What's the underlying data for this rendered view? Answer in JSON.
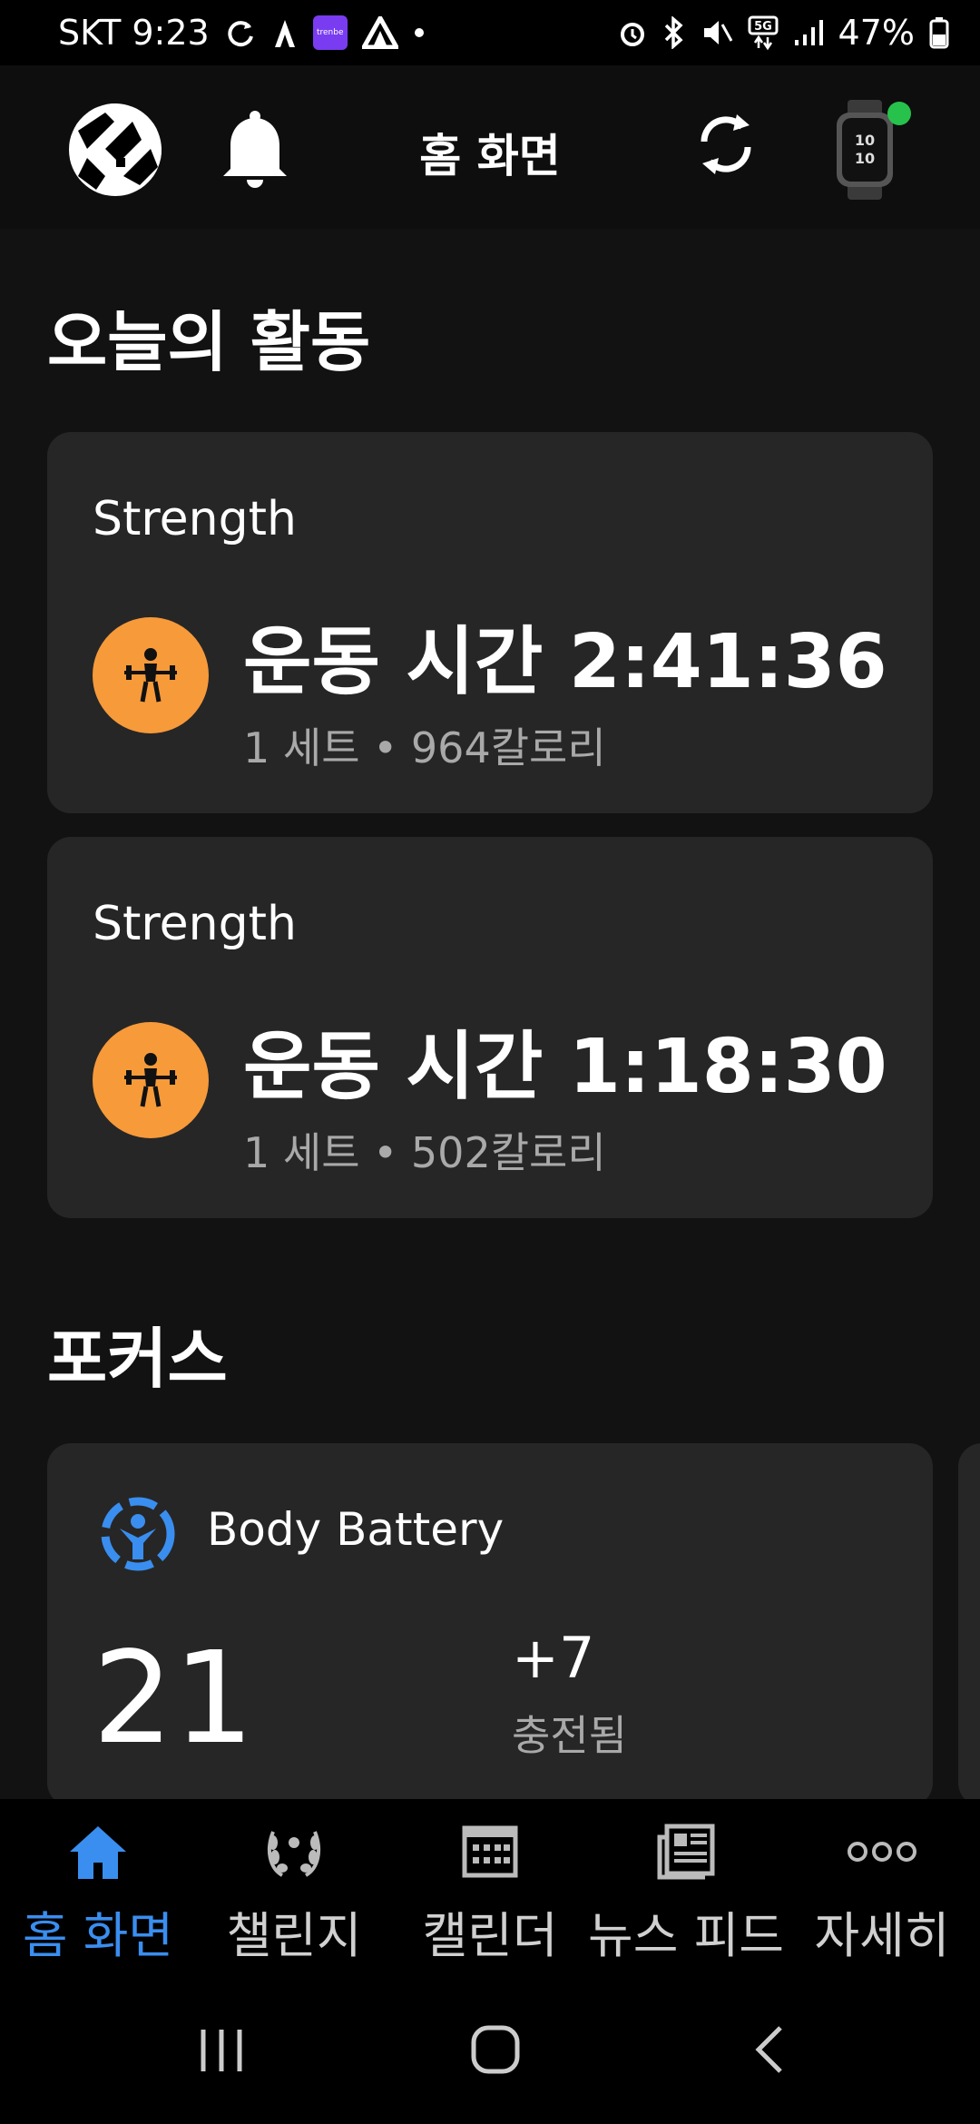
{
  "status_bar": {
    "carrier_time": "SKT 9:23",
    "app_badge": "trenbe",
    "network": "5G",
    "battery": "47%",
    "icons": [
      "sync-icon",
      "strava-icon",
      "app-badge-icon",
      "nav-app-icon",
      "dot-icon",
      "alarm-icon",
      "bluetooth-icon",
      "mute-icon",
      "5g-icon",
      "signal-icon",
      "battery-icon"
    ]
  },
  "header": {
    "title": "홈 화면",
    "icons": [
      "avatar",
      "bell-icon",
      "sync-icon",
      "watch-icon"
    ]
  },
  "today": {
    "title": "오늘의 활동",
    "activities": [
      {
        "type": "Strength",
        "main": "운동 시간 2:41:36",
        "sub": "1 세트 • 964칼로리"
      },
      {
        "type": "Strength",
        "main": "운동 시간 1:18:30",
        "sub": "1 세트 • 502칼로리"
      }
    ]
  },
  "focus": {
    "title": "포커스",
    "body_battery": {
      "label": "Body Battery",
      "value": "21",
      "delta": "+7",
      "delta_label": "충전됨"
    }
  },
  "bottom_nav": {
    "items": [
      {
        "label": "홈 화면",
        "icon": "home-icon",
        "active": true
      },
      {
        "label": "챌린지",
        "icon": "laurel-icon",
        "active": false
      },
      {
        "label": "캘린더",
        "icon": "calendar-icon",
        "active": false
      },
      {
        "label": "뉴스 피드",
        "icon": "newsfeed-icon",
        "active": false
      },
      {
        "label": "자세히",
        "icon": "more-icon",
        "active": false
      }
    ]
  },
  "colors": {
    "accent": "#3a8eef",
    "activity_orange": "#f79a3a",
    "device_online": "#27c24c",
    "card_bg": "#262626",
    "page_bg": "#121212"
  }
}
